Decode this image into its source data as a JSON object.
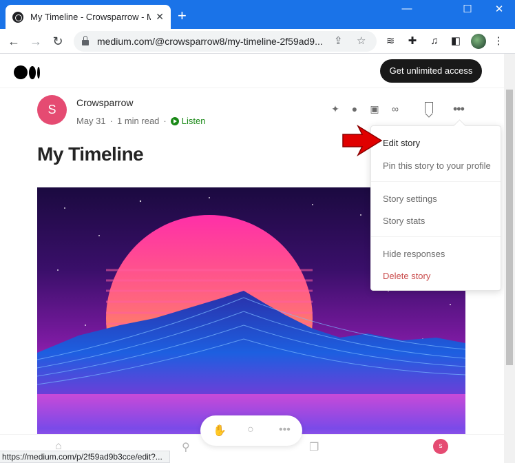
{
  "browser": {
    "tab_title": "My Timeline - Crowsparrow - Me",
    "tab_close": "✕",
    "new_tab": "+",
    "window_minimize": "—",
    "window_maximize": "☐",
    "window_close": "✕",
    "url": "medium.com/@crowsparrow8/my-timeline-2f59ad9...",
    "status_url": "https://medium.com/p/2f59ad9b3cce/edit?..."
  },
  "header": {
    "cta_label": "Get unlimited access"
  },
  "post": {
    "author_initial": "S",
    "author_name": "Crowsparrow",
    "date": "May 31",
    "read_time": "1 min read",
    "dot": "·",
    "listen_label": "Listen",
    "title": "My Timeline"
  },
  "menu": {
    "items": [
      {
        "label": "Edit story"
      },
      {
        "label": "Pin this story to your profile"
      },
      {
        "label": "Story settings"
      },
      {
        "label": "Story stats"
      },
      {
        "label": "Hide responses"
      },
      {
        "label": "Delete story"
      }
    ]
  },
  "bottom": {
    "profile_initial": "s"
  },
  "colors": {
    "browser_blue": "#1a73e8",
    "medium_green": "#1a8917",
    "avatar_pink": "#e54b72",
    "danger_red": "#c94a4a",
    "arrow_red": "#e00000"
  }
}
